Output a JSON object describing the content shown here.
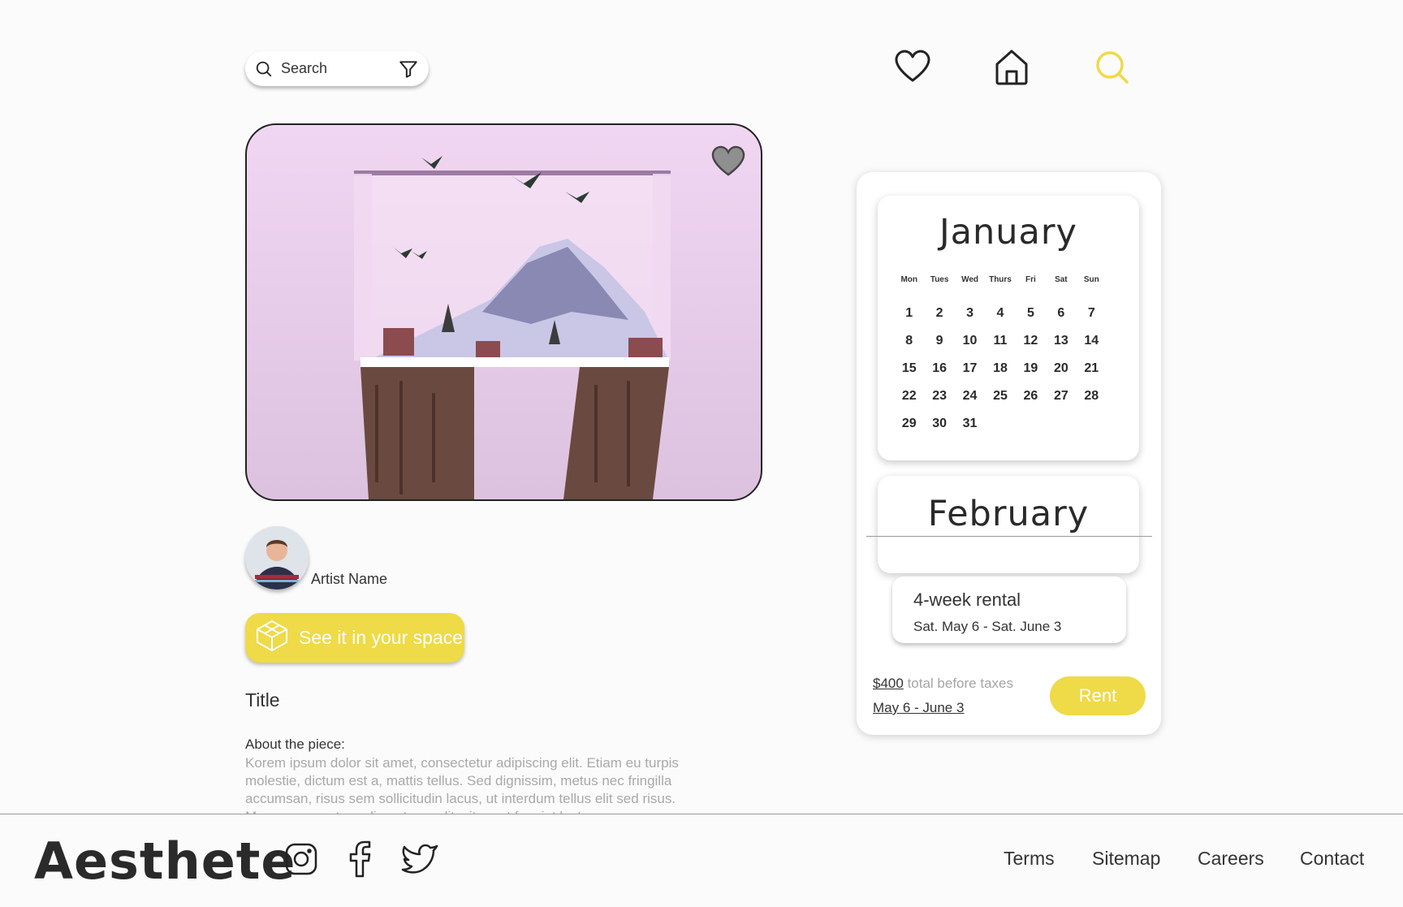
{
  "search": {
    "label": "Search"
  },
  "artwork": {
    "favorite_icon": "heart-icon"
  },
  "nav": {
    "icons": [
      "heart-icon",
      "home-icon",
      "search-icon"
    ],
    "active_color": "#efda47"
  },
  "artist": {
    "name": "Artist Name"
  },
  "ar_button": {
    "label": "See it in your space",
    "icon": "cube-icon"
  },
  "piece": {
    "title": "Title",
    "about_label": "About the piece:",
    "about_text": "Korem ipsum dolor sit amet, consectetur adipiscing elit. Etiam eu turpis molestie, dictum est a, mattis tellus. Sed dignissim, metus nec fringilla accumsan, risus sem sollicitudin lacus, ut interdum tellus elit sed risus. Maecenas eget condimentum velit, sit amet feugiat lectus."
  },
  "calendar": {
    "months": [
      {
        "name": "January",
        "weekdays": [
          "Mon",
          "Tues",
          "Wed",
          "Thurs",
          "Fri",
          "Sat",
          "Sun"
        ],
        "weeks": [
          [
            "1",
            "2",
            "3",
            "4",
            "5",
            "6",
            "7"
          ],
          [
            "8",
            "9",
            "10",
            "11",
            "12",
            "13",
            "14"
          ],
          [
            "15",
            "16",
            "17",
            "18",
            "19",
            "20",
            "21"
          ],
          [
            "22",
            "23",
            "24",
            "25",
            "26",
            "27",
            "28"
          ],
          [
            "29",
            "30",
            "31",
            "",
            "",
            "",
            ""
          ]
        ]
      },
      {
        "name": "February"
      }
    ]
  },
  "rental": {
    "title": "4-week rental",
    "dates": "Sat. May 6 - Sat. June 3"
  },
  "price": {
    "amount": "$400",
    "suffix": "total before taxes",
    "range": "May 6 - June 3"
  },
  "rent_button": {
    "label": "Rent"
  },
  "brand_color": "#efda47",
  "footer": {
    "brand": "Aesthete",
    "social_icons": [
      "instagram-icon",
      "facebook-icon",
      "twitter-icon"
    ],
    "links": [
      "Terms",
      "Sitemap",
      "Careers",
      "Contact"
    ]
  }
}
